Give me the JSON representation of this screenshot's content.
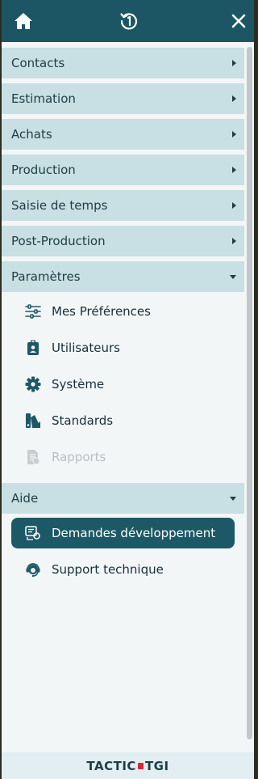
{
  "topbar": {
    "home_icon": "home-icon",
    "history_icon": "history-icon",
    "close_icon": "close-icon"
  },
  "sections": [
    {
      "label": "Contacts",
      "state": "collapsed"
    },
    {
      "label": "Estimation",
      "state": "collapsed"
    },
    {
      "label": "Achats",
      "state": "collapsed"
    },
    {
      "label": "Production",
      "state": "collapsed"
    },
    {
      "label": "Saisie de temps",
      "state": "collapsed"
    },
    {
      "label": "Post-Production",
      "state": "collapsed"
    },
    {
      "label": "Paramètres",
      "state": "expanded"
    },
    {
      "label": "Aide",
      "state": "expanded"
    }
  ],
  "parametres_items": [
    {
      "label": "Mes Préférences",
      "icon": "sliders-icon",
      "disabled": false
    },
    {
      "label": "Utilisateurs",
      "icon": "user-badge-icon",
      "disabled": false
    },
    {
      "label": "Système",
      "icon": "gear-icon",
      "disabled": false
    },
    {
      "label": "Standards",
      "icon": "swatches-icon",
      "disabled": false
    },
    {
      "label": "Rapports",
      "icon": "report-icon",
      "disabled": true
    }
  ],
  "aide_items": [
    {
      "label": "Demandes développement",
      "icon": "dev-request-icon",
      "active": true
    },
    {
      "label": "Support technique",
      "icon": "headset-icon",
      "active": false
    }
  ],
  "footer": {
    "logo_left": "TACTIC",
    "logo_right": "TGI"
  },
  "colors": {
    "header": "#1c5664",
    "section_bg": "#c8dfe3",
    "active_item": "#1d5866",
    "logo_accent": "#d6283b"
  }
}
